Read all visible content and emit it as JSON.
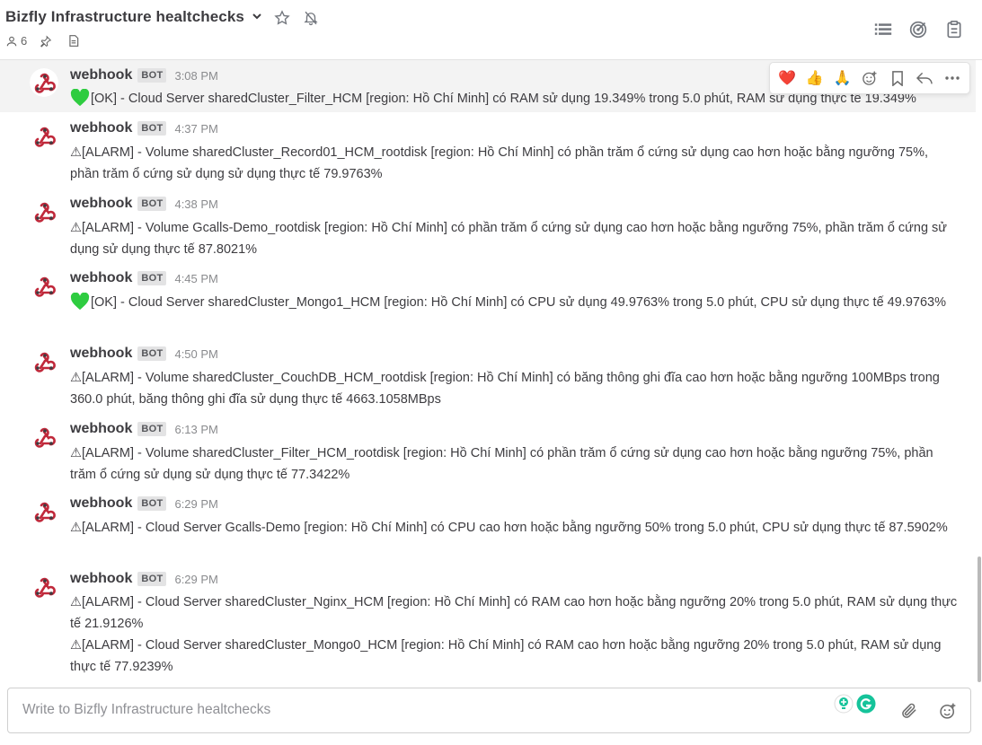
{
  "header": {
    "title": "Bizfly Infrastructure healtchecks",
    "member_count": "6"
  },
  "post_menu": {
    "reactions": [
      "❤️",
      "👍",
      "🙏"
    ]
  },
  "posts": [
    {
      "username": "webhook",
      "badge": "BOT",
      "time": "3:08 PM",
      "lines": [
        "[OK] - Cloud Server sharedCluster_Filter_HCM [region: Hồ Chí Minh] có RAM sử dụng 19.349% trong 5.0 phút, RAM sử dụng thực tế 19.349%"
      ]
    },
    {
      "username": "webhook",
      "badge": "BOT",
      "time": "4:37 PM",
      "lines": [
        "⚠[ALARM] - Volume sharedCluster_Record01_HCM_rootdisk [region: Hồ Chí Minh] có phần trăm ổ cứng sử dụng cao hơn hoặc bằng ngưỡng 75%, phần trăm ổ cứng sử dụng sử dụng thực tế 79.9763%"
      ]
    },
    {
      "username": "webhook",
      "badge": "BOT",
      "time": "4:38 PM",
      "lines": [
        "⚠[ALARM] - Volume Gcalls-Demo_rootdisk [region: Hồ Chí Minh] có phần trăm ổ cứng sử dụng cao hơn hoặc bằng ngưỡng 75%, phần trăm ổ cứng sử dụng sử dụng thực tế 87.8021%"
      ]
    },
    {
      "username": "webhook",
      "badge": "BOT",
      "time": "4:45 PM",
      "lines": [
        "[OK] - Cloud Server sharedCluster_Mongo1_HCM [region: Hồ Chí Minh] có CPU sử dụng 49.9763% trong 5.0 phút, CPU sử dụng thực tế 49.9763%"
      ]
    },
    {
      "username": "webhook",
      "badge": "BOT",
      "time": "4:50 PM",
      "lines": [
        "⚠[ALARM] - Volume sharedCluster_CouchDB_HCM_rootdisk [region: Hồ Chí Minh] có băng thông ghi đĩa cao hơn hoặc bằng ngưỡng 100MBps trong 360.0 phút, băng thông ghi đĩa sử dụng thực tế 4663.1058MBps"
      ]
    },
    {
      "username": "webhook",
      "badge": "BOT",
      "time": "6:13 PM",
      "lines": [
        "⚠[ALARM] - Volume sharedCluster_Filter_HCM_rootdisk [region: Hồ Chí Minh] có phần trăm ổ cứng sử dụng cao hơn hoặc bằng ngưỡng 75%, phần trăm ổ cứng sử dụng sử dụng thực tế 77.3422%"
      ]
    },
    {
      "username": "webhook",
      "badge": "BOT",
      "time": "6:29 PM",
      "lines": [
        "⚠[ALARM] - Cloud Server Gcalls-Demo [region: Hồ Chí Minh] có CPU cao hơn hoặc bằng ngưỡng 50% trong 5.0 phút, CPU sử dụng thực tế 87.5902%"
      ]
    },
    {
      "username": "webhook",
      "badge": "BOT",
      "time": "6:29 PM",
      "lines": [
        "⚠[ALARM] - Cloud Server sharedCluster_Nginx_HCM [region: Hồ Chí Minh] có RAM cao hơn hoặc bằng ngưỡng 20% trong 5.0 phút, RAM sử dụng thực tế 21.9126%",
        "⚠[ALARM] - Cloud Server sharedCluster_Mongo0_HCM [region: Hồ Chí Minh] có RAM cao hơn hoặc bằng ngưỡng 20% trong 5.0 phút, RAM sử dụng thực tế 77.9239%"
      ]
    }
  ],
  "composer": {
    "placeholder": "Write to Bizfly Infrastructure healtchecks"
  },
  "colors": {
    "ok_heart": "#2ecc40",
    "avatar_red": "#c0293b",
    "text": "#3d3c40"
  }
}
